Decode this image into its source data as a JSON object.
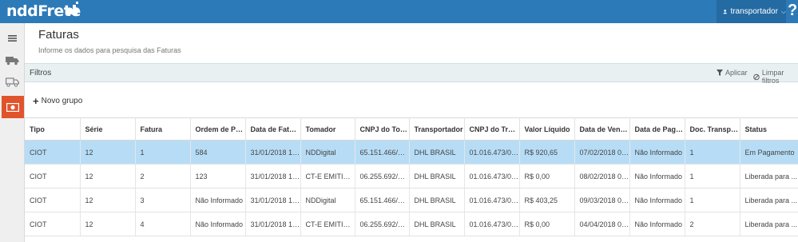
{
  "app": {
    "logo_text": "nddFrete"
  },
  "header": {
    "user_label": "transportador",
    "user_caret": "⌵",
    "help_label": "?"
  },
  "sidebar": {
    "items": [
      {
        "name": "menu",
        "icon": "hamburger-icon"
      },
      {
        "name": "truck",
        "icon": "truck-icon"
      },
      {
        "name": "truck-outline",
        "icon": "truck-outline-icon"
      },
      {
        "name": "faturas",
        "icon": "money-icon",
        "active": true
      }
    ]
  },
  "page": {
    "title": "Faturas",
    "subtitle": "Informe os dados para pesquisa das Faturas"
  },
  "filters": {
    "title": "Filtros",
    "apply_label": "Aplicar",
    "clear_label": "Limpar filtros",
    "new_group_label": "Novo grupo"
  },
  "table": {
    "columns": [
      "Tipo",
      "Série",
      "Fatura",
      "Ordem de Pa...",
      "Data de Fatur...",
      "Tomador",
      "CNPJ do Tom...",
      "Transportador",
      "CNPJ do Tran...",
      "Valor Líquido",
      "Data de Venc...",
      "Data de Paga...",
      "Doc. Transpo...",
      "Status"
    ],
    "rows": [
      [
        "CIOT",
        "12",
        "1",
        "584",
        "31/01/2018 14...",
        "NDDigital",
        "65.151.466/00...",
        "DHL BRASIL",
        "01.016.473/00...",
        "R$ 920,65",
        "07/02/2018 00:...",
        "Não Informado",
        "1",
        "Em Pagamento"
      ],
      [
        "CIOT",
        "12",
        "2",
        "123",
        "31/01/2018 15...",
        "CT-E EMITIDO ...",
        "06.255.692/00...",
        "DHL BRASIL",
        "01.016.473/00...",
        "R$ 0,00",
        "08/02/2018 00:...",
        "Não Informado",
        "1",
        "Liberada para ..."
      ],
      [
        "CIOT",
        "12",
        "3",
        "Não Informado",
        "31/01/2018 15...",
        "NDDigital",
        "65.151.466/00...",
        "DHL BRASIL",
        "01.016.473/00...",
        "R$ 403,25",
        "09/03/2018 00:...",
        "Não Informado",
        "1",
        "Liberada para ..."
      ],
      [
        "CIOT",
        "12",
        "4",
        "Não Informado",
        "31/01/2018 15...",
        "CT-E EMITIDO ...",
        "06.255.692/00...",
        "DHL BRASIL",
        "01.016.473/00...",
        "R$ 0,00",
        "04/04/2018 00:...",
        "Não Informado",
        "2",
        "Liberada para ..."
      ]
    ],
    "selected_row": 0
  },
  "colors": {
    "topbar": "#2d7ab8",
    "active_side": "#e0542c",
    "selected_row": "#b7ddf6",
    "filter_bar": "#e8f0f2"
  }
}
